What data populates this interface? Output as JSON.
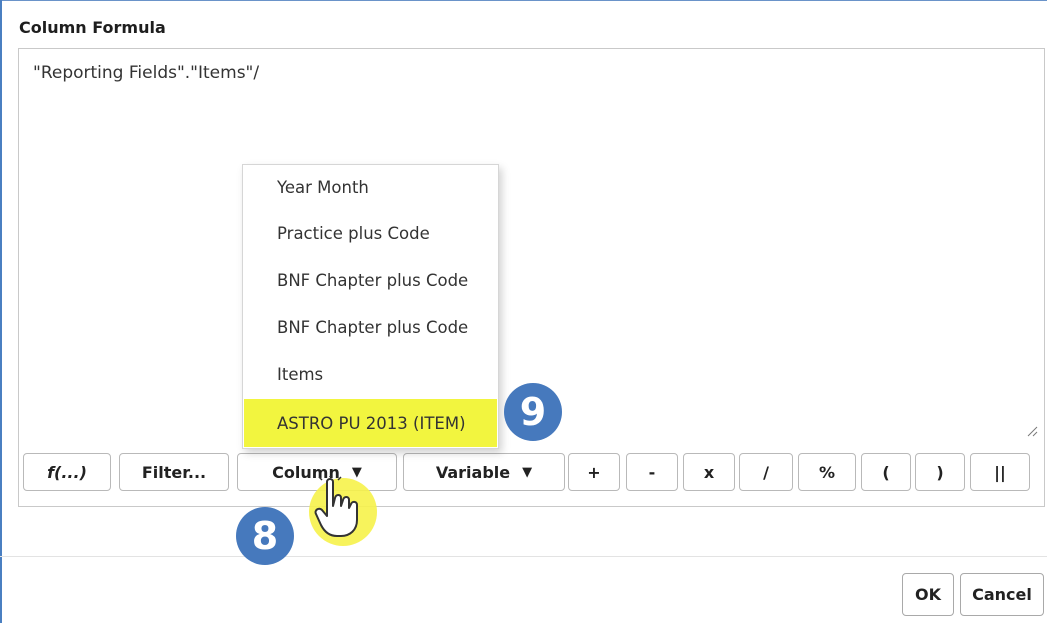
{
  "dialog": {
    "title": "Column Formula",
    "formula_text": "\"Reporting Fields\".\"Items\"/"
  },
  "toolbar": {
    "buttons": [
      {
        "label": "f(...)"
      },
      {
        "label": "Filter..."
      },
      {
        "label": "Column",
        "caret": "▼"
      },
      {
        "label": "Variable",
        "caret": "▼"
      },
      {
        "label": "+"
      },
      {
        "label": "-"
      },
      {
        "label": "x"
      },
      {
        "label": "/"
      },
      {
        "label": "%"
      },
      {
        "label": "("
      },
      {
        "label": ")"
      },
      {
        "label": "||"
      }
    ]
  },
  "column_menu": {
    "items": [
      {
        "label": "Year Month"
      },
      {
        "label": "Practice plus Code"
      },
      {
        "label": "BNF Chapter plus Code"
      },
      {
        "label": "BNF Chapter plus Code"
      },
      {
        "label": "Items"
      },
      {
        "label": "ASTRO PU 2013 (ITEM)",
        "highlighted": true
      }
    ]
  },
  "annotations": {
    "step_8": "8",
    "step_9": "9"
  },
  "footer": {
    "ok_label": "OK",
    "cancel_label": "Cancel"
  },
  "colors": {
    "highlight": "#f2f53f",
    "badge": "#4679bd",
    "frame": "#4a7fc1"
  }
}
